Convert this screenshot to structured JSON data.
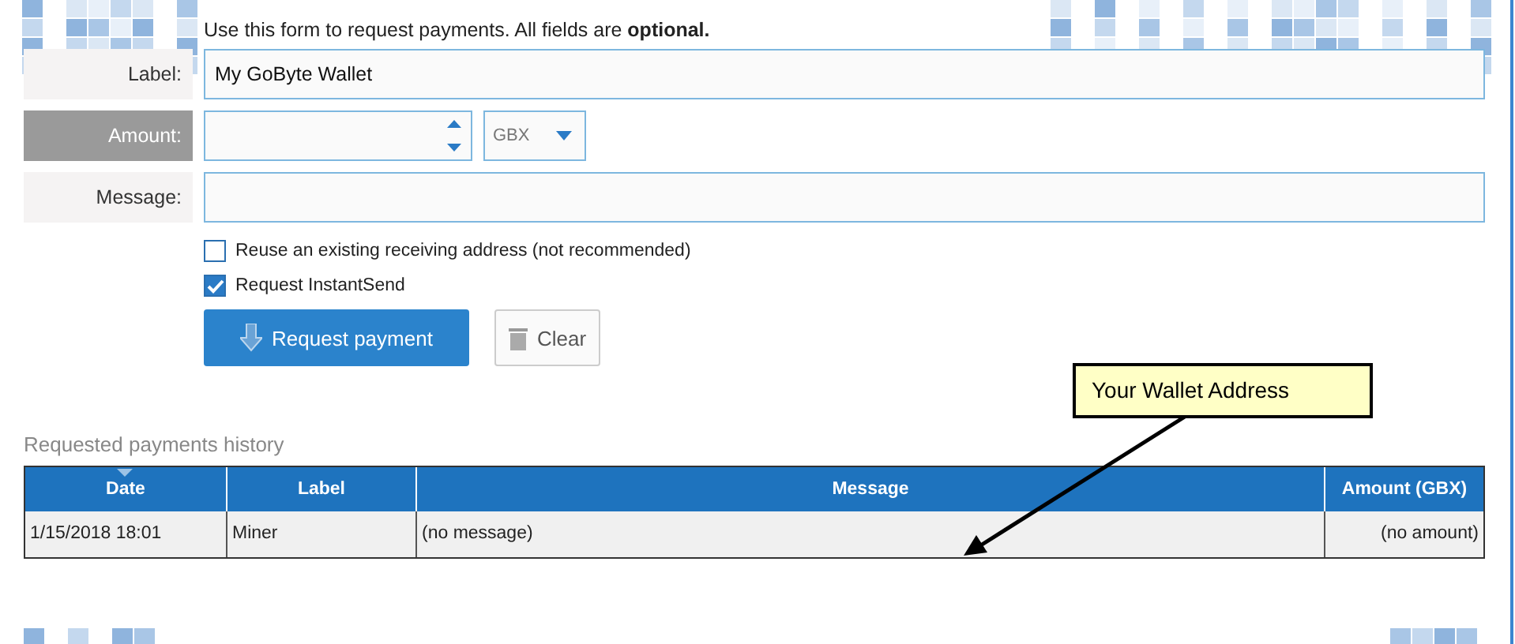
{
  "intro": "Use this form to request payments. All fields are **optional.**",
  "form": [
    {
      "kind": "text",
      "caption": "Label:",
      "value": "My GoByte Wallet",
      "focused": false
    },
    {
      "kind": "amount",
      "caption": "Amount:",
      "unit": "GBX",
      "focused": true
    },
    {
      "kind": "text",
      "caption": "Message:",
      "focused": false
    }
  ],
  "options": [
    {
      "label": "Reuse an existing receiving address (not recommended)",
      "checked": false
    },
    {
      "label": "Request InstantSend",
      "checked": true
    }
  ],
  "buttons": [
    {
      "label": "Request payment",
      "kind": "primary"
    },
    {
      "label": "Clear",
      "kind": "secondary"
    }
  ],
  "callout": {
    "text": "Your Wallet Address"
  },
  "history": {
    "title": "Requested payments history",
    "columns": [
      {
        "label": "Date",
        "sorted": true
      },
      {
        "label": "Label",
        "sorted": false
      },
      {
        "label": "Message",
        "sorted": false
      },
      {
        "label": "Amount (GBX)",
        "sorted": false
      }
    ],
    "rows": [
      {
        "cells": [
          "1/15/2018 18:01",
          "Miner",
          "(no message)",
          "(no amount)"
        ]
      }
    ]
  }
}
